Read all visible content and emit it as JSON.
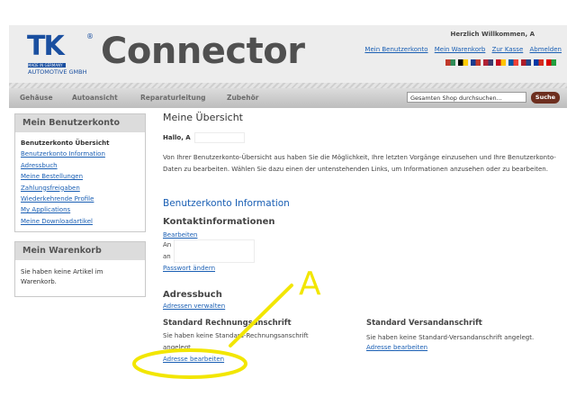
{
  "header": {
    "logo_text": "TK",
    "logo_sub": "AUTOMOTIVE GMBH",
    "logo_mig": "MADE IN GERMANY",
    "brand": "Connector",
    "welcome": "Herzlich Willkommen, A",
    "links": [
      "Mein Benutzerkonto",
      "Mein Warenkorb",
      "Zur Kasse",
      "Abmelden"
    ],
    "flags": [
      [
        "#c0392b",
        "#2e8b57"
      ],
      [
        "#000000",
        "#ffcc00"
      ],
      [
        "#1a3c8f",
        "#c0392b"
      ],
      [
        "#b22234",
        "#3c3b6e"
      ],
      [
        "#c60b1e",
        "#ffc400"
      ],
      [
        "#0055a4",
        "#ef4135"
      ],
      [
        "#ae1c28",
        "#21468b"
      ],
      [
        "#0039a6",
        "#d52b1e"
      ],
      [
        "#da0000",
        "#239f40"
      ]
    ]
  },
  "nav": {
    "items": [
      "Gehäuse",
      "Autoansicht",
      "Reparaturleitung",
      "Zubehör"
    ],
    "search_placeholder": "Gesamten Shop durchsuchen...",
    "search_button": "Suche"
  },
  "sidebar": {
    "account_title": "Mein Benutzerkonto",
    "account_items": [
      "Benutzerkonto Übersicht",
      "Benutzerkonto Information",
      "Adressbuch",
      "Meine Bestellungen",
      "Zahlungsfreigaben",
      "Wiederkehrende Profile",
      "My Applications",
      "Meine Downloadartikel"
    ],
    "cart_title": "Mein Warenkorb",
    "cart_text": "Sie haben keine Artikel im Warenkorb."
  },
  "main": {
    "title": "Meine Übersicht",
    "hello": "Hallo, A",
    "intro": "Von Ihrer Benutzerkonto-Übersicht aus haben Sie die Möglichkeit, Ihre letzten Vorgänge einzusehen und Ihre Benutzerkonto-Daten zu bearbeiten. Wählen Sie dazu einen der untenstehenden Links, um Informationen anzusehen oder zu bearbeiten.",
    "account_info_heading": "Benutzerkonto Information",
    "contact_heading": "Kontaktinformationen",
    "edit_link": "Bearbeiten",
    "contact_line1": "An",
    "contact_line2": "an",
    "password_link": "Passwort ändern",
    "addressbook_heading": "Adressbuch",
    "manage_addresses": "Adressen verwalten",
    "billing_heading": "Standard Rechnungsanschrift",
    "billing_text": "Sie haben keine Standard-Rechnungsanschrift angelegt.",
    "billing_edit": "Adresse bearbeiten",
    "shipping_heading": "Standard Versandanschrift",
    "shipping_text": "Sie haben keine Standard-Versandanschrift angelegt.",
    "shipping_edit": "Adresse bearbeiten"
  },
  "annotation": {
    "label": "A",
    "color": "#f2e600"
  }
}
